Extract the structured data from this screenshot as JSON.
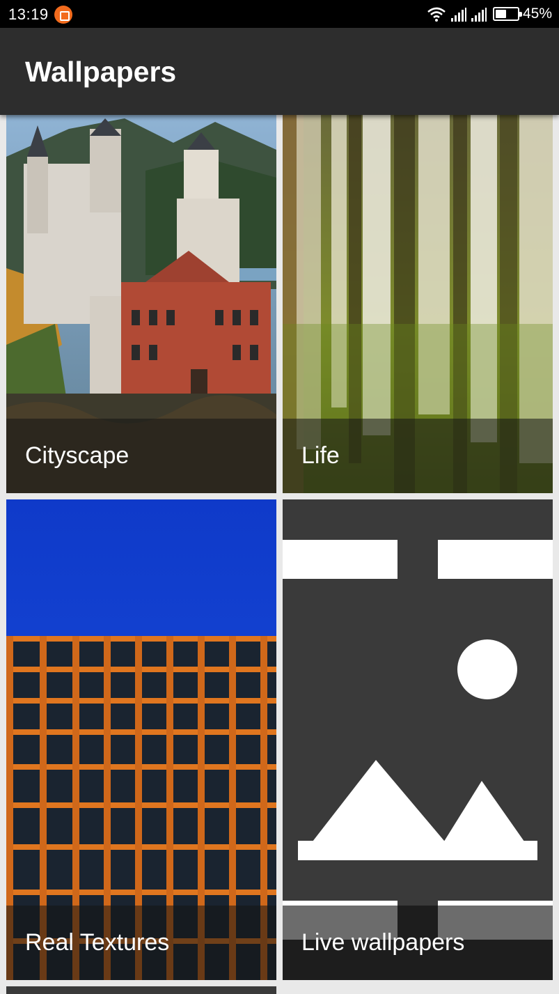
{
  "status_bar": {
    "time": "13:19",
    "battery_percent": "45%",
    "battery_level": 0.45,
    "icons": [
      "notification-icon",
      "wifi-icon",
      "signal-icon",
      "signal-icon",
      "battery-icon"
    ]
  },
  "app_bar": {
    "title": "Wallpapers"
  },
  "tiles": [
    {
      "label": "Cityscape",
      "image": "castle-photo"
    },
    {
      "label": "Life",
      "image": "forest-blur-photo"
    },
    {
      "label": "Real Textures",
      "image": "building-facade-photo"
    },
    {
      "label": "Live wallpapers",
      "image": "image-placeholder-icon"
    }
  ],
  "colors": {
    "app_bar": "#2d2d2d",
    "status_bar": "#000000",
    "background": "#e9e9e9",
    "notification_accent": "#f26b1d"
  }
}
